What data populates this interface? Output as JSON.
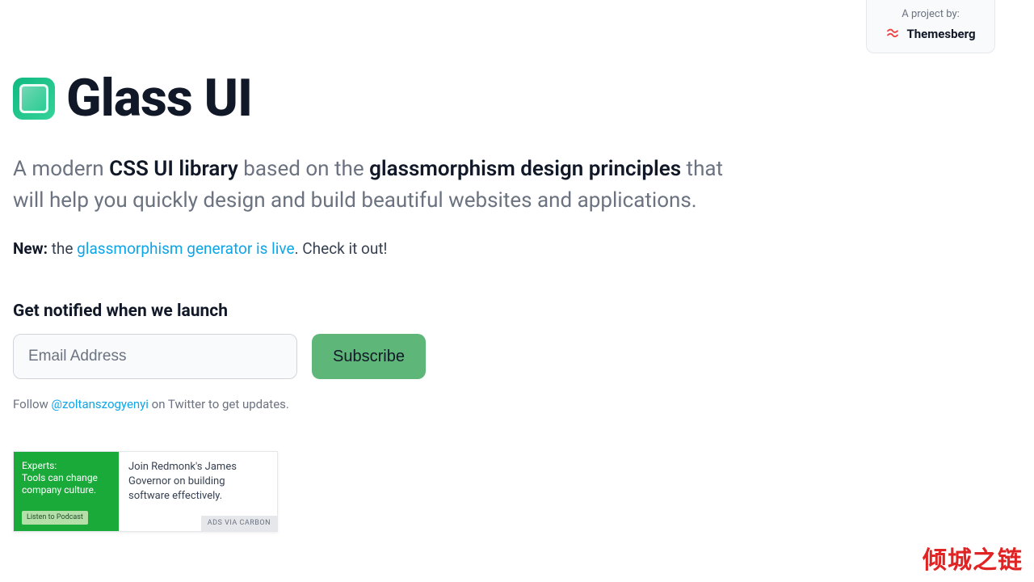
{
  "project_badge": {
    "label": "A project by:",
    "brand": "Themesberg"
  },
  "brand": {
    "title": "Glass UI"
  },
  "tagline": {
    "prefix": "A modern ",
    "strong1": "CSS UI library",
    "mid": " based on the ",
    "strong2": "glassmorphism design principles",
    "suffix": " that will help you quickly design and build beautiful websites and applications."
  },
  "new_line": {
    "bold": "New:",
    "before_link": " the ",
    "link": "glassmorphism generator is live",
    "after_link": ". Check it out!"
  },
  "notify": {
    "heading": "Get notified when we launch",
    "email_placeholder": "Email Address",
    "subscribe_label": "Subscribe"
  },
  "follow": {
    "prefix": "Follow ",
    "handle": "@zoltanszogyenyi",
    "suffix": " on Twitter to get updates."
  },
  "ad": {
    "image_headline": "Experts:\nTools can change company culture.",
    "image_cta": "Listen to Podcast",
    "text": "Join Redmonk's James Governor on building software effectively.",
    "via": "ADS VIA CARBON"
  },
  "watermark": "倾城之链"
}
